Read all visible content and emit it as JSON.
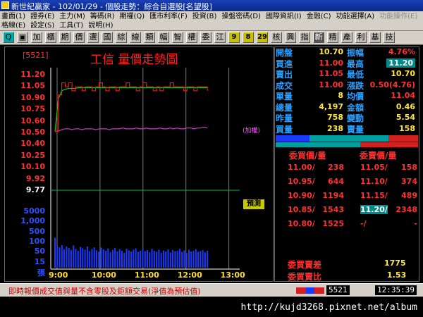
{
  "window": {
    "title": "新世紀贏家 - 102/01/29 - 個股走勢：綜合自選股[名望股]"
  },
  "menu": {
    "row1": [
      "畫面(1)",
      "證券(E)",
      "主力(M)",
      "籌碼(R)",
      "期權(Q)",
      "匯市利率(F)",
      "投資(B)",
      "操盤密碼(D)",
      "國際資訊(I)",
      "金融(C)",
      "功能選擇(A)",
      "功能操作(E)"
    ],
    "row1_disabled": [
      false,
      false,
      false,
      false,
      false,
      false,
      false,
      false,
      false,
      false,
      false,
      true
    ],
    "row2": [
      "格線(E)",
      "設定(S)",
      "工具(T)",
      "說明(H)"
    ]
  },
  "toolbar": {
    "buttons": [
      "Q",
      "▣",
      "加",
      "櫃",
      "期",
      "價",
      "選",
      "國",
      "綜",
      "線",
      "類",
      "幅",
      "智",
      "權",
      "委",
      "江",
      "9",
      "8",
      "29",
      "核",
      "興",
      "指",
      "新",
      "精",
      "產",
      "利",
      "基",
      "技"
    ],
    "styles": [
      "hl",
      "",
      "",
      "",
      "",
      "",
      "",
      "",
      "",
      "",
      "",
      "",
      "",
      "",
      "",
      "",
      "num",
      "num",
      "num",
      "",
      "",
      "",
      "dark",
      "",
      "",
      "",
      "",
      ""
    ]
  },
  "chart_header": {
    "code": "[5521]",
    "title": "工信  量價走勢圖"
  },
  "chart_data": {
    "type": "line",
    "price_axis": {
      "ticks": [
        "11.20",
        "11.05",
        "10.90",
        "10.75",
        "10.60",
        "10.50",
        "10.40",
        "10.25",
        "10.10",
        "9.92",
        "9.77"
      ],
      "ylim": [
        9.77,
        11.2
      ]
    },
    "volume_axis": {
      "ticks": [
        "5000",
        "1,000",
        "500",
        "100",
        "50",
        "15",
        "張"
      ]
    },
    "time_ticks": [
      "9:00",
      "10:00",
      "11:00",
      "12:00",
      "13:00"
    ],
    "price_series": [
      10.5,
      10.95,
      11.1,
      11.05,
      11.1,
      11.0,
      11.05,
      11.05,
      11.0,
      11.05,
      11.05,
      11.0,
      11.05,
      11.1,
      11.05,
      11.0,
      11.05,
      11.05,
      11.0,
      11.05,
      11.05,
      11.1,
      11.05,
      11.05,
      11.0,
      11.05,
      11.1,
      11.05,
      11.05,
      11.0,
      11.05,
      11.0,
      11.05,
      11.05,
      11.1,
      11.05,
      11.05,
      11.05,
      11.0,
      11.05,
      11.05,
      11.0,
      11.05,
      11.05,
      11.05,
      11.0
    ],
    "avg_series": [
      10.5,
      10.9,
      11.0,
      11.02,
      11.03,
      11.03,
      11.03,
      11.04,
      11.04,
      11.04,
      11.04,
      11.04,
      11.04,
      11.04,
      11.04,
      11.04,
      11.04,
      11.04,
      11.04,
      11.04,
      11.04,
      11.04,
      11.04,
      11.04,
      11.04,
      11.04,
      11.04,
      11.04,
      11.04,
      11.04,
      11.04,
      11.04,
      11.04,
      11.04,
      11.04,
      11.04,
      11.04,
      11.04,
      11.04,
      11.04,
      11.04,
      11.04,
      11.04,
      11.04,
      11.04,
      11.04
    ],
    "index_series": [
      10.5,
      10.5,
      10.52,
      10.53,
      10.53,
      10.52,
      10.53,
      10.53,
      10.52,
      10.53,
      10.53,
      10.53,
      10.52,
      10.53,
      10.53,
      10.53,
      10.52,
      10.53,
      10.53,
      10.53,
      10.54,
      10.53,
      10.53,
      10.53,
      10.54,
      10.53,
      10.53,
      10.54,
      10.53,
      10.53,
      10.53,
      10.54,
      10.53,
      10.53,
      10.54,
      10.53,
      10.54,
      10.53,
      10.53,
      10.54,
      10.54,
      10.53,
      10.54,
      10.54,
      10.55,
      10.54
    ],
    "volume_series": [
      420,
      80,
      60,
      95,
      40,
      70,
      55,
      35,
      90,
      45,
      30,
      65,
      50,
      38,
      72,
      28,
      44,
      60,
      33,
      25,
      58,
      40,
      30,
      48,
      22,
      36,
      55,
      27,
      42,
      30,
      20,
      45,
      33,
      26,
      38,
      50,
      24,
      30,
      41,
      28,
      35,
      22,
      46,
      30,
      25,
      38,
      20,
      32,
      27,
      40,
      22,
      35,
      28,
      30,
      45,
      25,
      33,
      20,
      38,
      26,
      30,
      42,
      24,
      28,
      35,
      22,
      30
    ],
    "volume_max": 5000,
    "colors": {
      "price": "#e02010",
      "avg": "#20c020",
      "index": "#c040c0",
      "volume": "#1a3aff",
      "grid_v": "#7a7a7a",
      "grid_h": "#00b050"
    }
  },
  "annotations": {
    "index_label": "(加權)",
    "preview_tag": "預測"
  },
  "quote": {
    "rows": [
      {
        "l1": "開盤",
        "v1": "10.70",
        "c1": "yellow",
        "l2": "振幅",
        "v2": "4.76%",
        "c2": "red"
      },
      {
        "l1": "買進",
        "v1": "11.00",
        "c1": "red",
        "l2": "最高",
        "v2": "11.20",
        "c2": "hl"
      },
      {
        "l1": "賣出",
        "v1": "11.05",
        "c1": "red",
        "l2": "最低",
        "v2": "10.70",
        "c2": "yellow"
      },
      {
        "l1": "成交",
        "v1": "11.00",
        "c1": "red",
        "l2": "漲跌",
        "v2": "0.50(4.76)",
        "c2": "red"
      },
      {
        "l1": "單量",
        "v1": "8",
        "c1": "yellow",
        "l2": "均價",
        "v2": "11.04",
        "c2": "red"
      },
      {
        "l1": "總量",
        "v1": "4,197",
        "c1": "yellow",
        "l2": "金額",
        "v2": "0.46",
        "c2": "yellow"
      },
      {
        "l1": "昨量",
        "v1": "758",
        "c1": "yellow",
        "l2": "變動",
        "v2": "5.54",
        "c2": "yellow"
      },
      {
        "l1": "買量",
        "v1": "238",
        "c1": "yellow",
        "l2": "賣量",
        "v2": "158",
        "c2": "yellow"
      }
    ]
  },
  "order_book": {
    "buy_header": "委買價/量",
    "sell_header": "委賣價/量",
    "rows": [
      {
        "bp": "11.00/",
        "bv": "238",
        "sp": "11.05/",
        "sv": "158",
        "bp_c": "red",
        "sp_c": "red",
        "sp_hl": false
      },
      {
        "bp": "10.95/",
        "bv": "644",
        "sp": "11.10/",
        "sv": "374",
        "bp_c": "red",
        "sp_c": "red",
        "sp_hl": false
      },
      {
        "bp": "10.90/",
        "bv": "1194",
        "sp": "11.15/",
        "sv": "489",
        "bp_c": "red",
        "sp_c": "red",
        "sp_hl": false
      },
      {
        "bp": "10.85/",
        "bv": "1543",
        "sp": "11.20/",
        "sv": "2348",
        "bp_c": "red",
        "sp_c": "white",
        "sp_hl": true
      },
      {
        "bp": "10.80/",
        "bv": "1525",
        "sp": "-/",
        "sv": "-",
        "bp_c": "red",
        "sp_c": "red",
        "sp_hl": false
      }
    ]
  },
  "summary": {
    "diff_label": "委買賣差",
    "diff_value": "1775",
    "ratio_label": "委買賣比",
    "ratio_value": "1.53"
  },
  "status": {
    "message": "即時報價成交值與量不含零股及鉅額交易(淨值為預估值)",
    "code": "5521",
    "time": "12:35:39"
  },
  "url": "http://kujd3268.pixnet.net/album"
}
